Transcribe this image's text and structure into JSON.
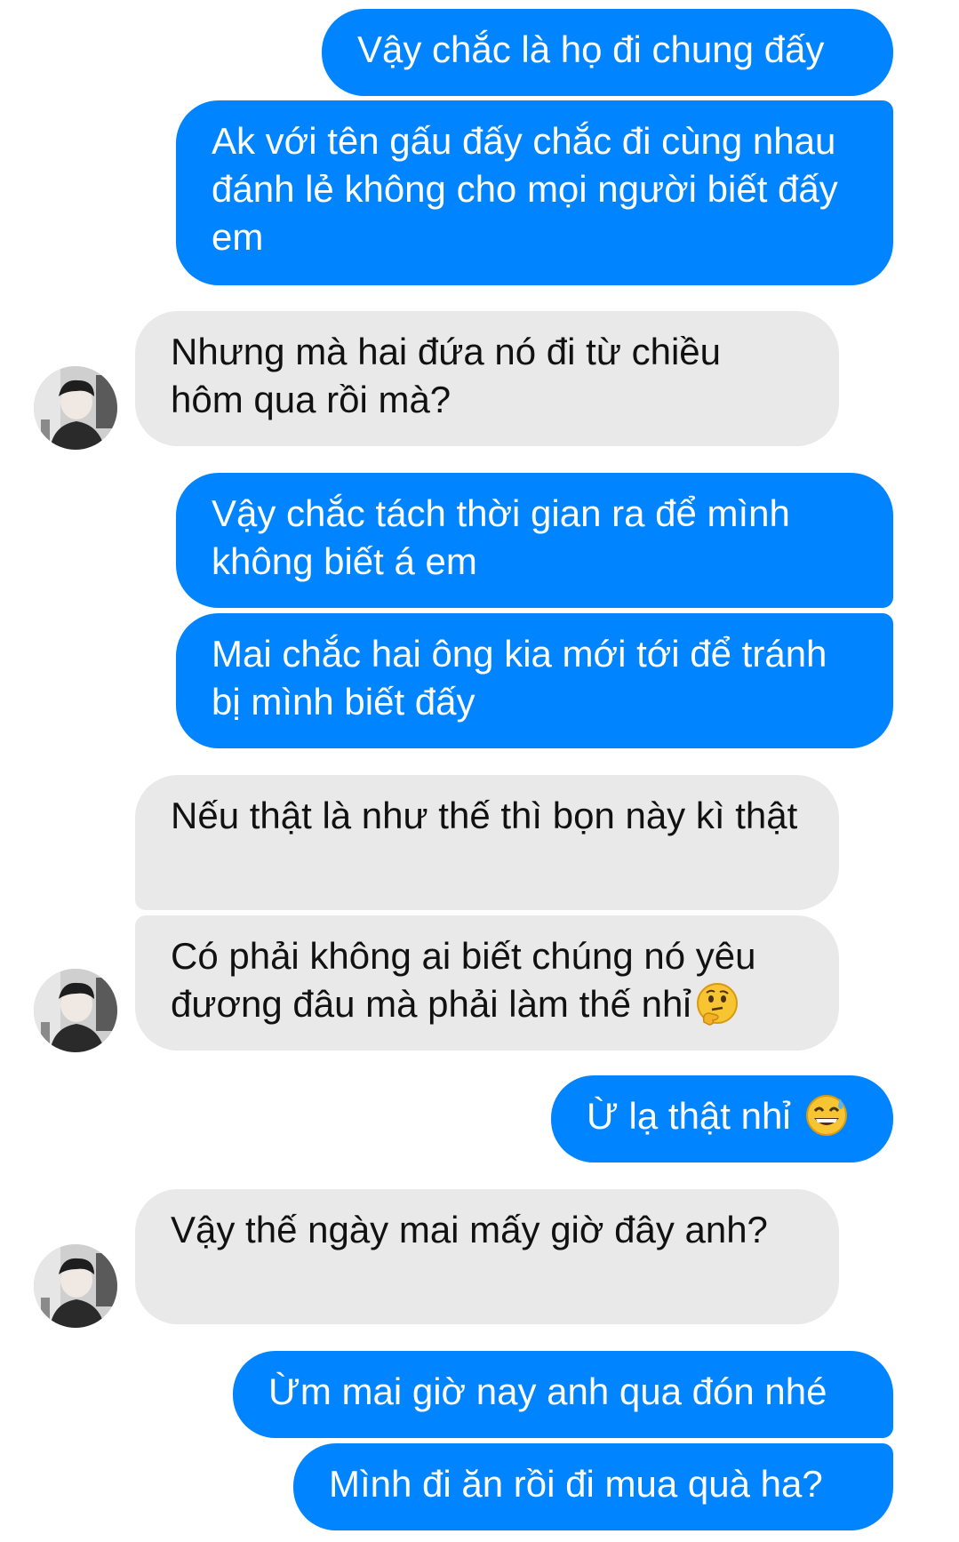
{
  "conversation": {
    "messages": [
      {
        "text": "Vậy chắc là họ đi chung đấy"
      },
      {
        "text": "Ak với tên gấu đấy chắc đi cùng nhau đánh lẻ không cho mọi người biết đấy em"
      },
      {
        "text": "Nhưng mà hai đứa nó đi từ chiều hôm qua rồi mà?"
      },
      {
        "text": "Vậy chắc tách thời gian ra để mình không biết á em"
      },
      {
        "text": "Mai chắc hai ông kia mới tới để tránh bị mình biết đấy"
      },
      {
        "text": "Nếu thật là như thế thì bọn này kì thật"
      },
      {
        "text": "Có phải không ai biết chúng nó yêu đương đâu mà phải làm thế nhỉ",
        "emoji": "thinking-face-emoji"
      },
      {
        "text": "Ừ lạ thật nhỉ ",
        "emoji": "grinning-sweat-emoji"
      },
      {
        "text": "Vậy thế ngày mai mấy giờ đây anh?"
      },
      {
        "text": "Ừm mai giờ nay anh qua đón nhé"
      },
      {
        "text": "Mình đi ăn rồi đi mua quà ha?"
      }
    ]
  },
  "colors": {
    "outgoing_bubble": "#0084ff",
    "incoming_bubble": "#e9e9e9",
    "outgoing_text": "#ffffff",
    "incoming_text": "#111111"
  }
}
